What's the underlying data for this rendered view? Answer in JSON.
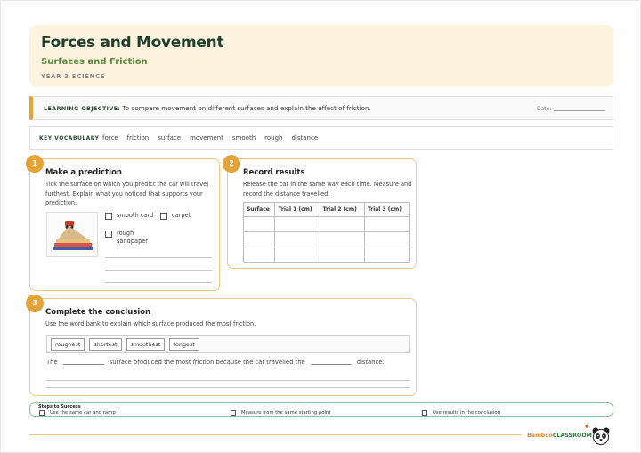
{
  "header": {
    "title": "Forces and Movement",
    "subtitle": "Surfaces and Friction",
    "year": "YEAR 3 SCIENCE"
  },
  "objective": {
    "label": "LEARNING OBJECTIVE:",
    "text": "To compare movement on different surfaces and explain the effect of friction.",
    "date_label": "Date:"
  },
  "vocabulary": {
    "label": "KEY VOCABULARY",
    "words": [
      "force",
      "friction",
      "surface",
      "movement",
      "smooth",
      "rough",
      "distance"
    ]
  },
  "prediction": {
    "number": "1",
    "title": "Make a prediction",
    "instructions": "Tick the surface on which you predict the car will travel furthest. Explain what you noticed that supports your prediction.",
    "image_icon": "car-on-ramp-picture",
    "options": [
      "smooth card",
      "carpet",
      "rough sandpaper"
    ]
  },
  "results": {
    "number": "2",
    "title": "Record results",
    "instructions": "Release the car in the same way each time. Measure and record the distance travelled.",
    "columns": [
      "Surface",
      "Trial 1 (cm)",
      "Trial 2 (cm)",
      "Trial 3 (cm)"
    ],
    "rows": [
      [
        "",
        "",
        "",
        ""
      ],
      [
        "",
        "",
        "",
        ""
      ],
      [
        "",
        "",
        "",
        ""
      ]
    ]
  },
  "conclusion": {
    "number": "3",
    "title": "Complete the conclusion",
    "instructions": "Use the word bank to explain which surface produced the most friction.",
    "word_bank": [
      "roughest",
      "shortest",
      "smoothest",
      "longest"
    ],
    "sentence": {
      "part1": "The",
      "part2": "surface produced the most friction because the car travelled the",
      "part3": "distance."
    }
  },
  "steps": {
    "title": "Steps to Success",
    "items": [
      "Use the same car and ramp",
      "Measure from the same starting point",
      "Use results in the conclusion"
    ]
  },
  "footer": {
    "brand_part1": "Bamboo",
    "brand_part2": "CLASSROOM",
    "logo_icon": "panda-logo-icon"
  },
  "colors": {
    "accent": "#e3a33b",
    "header_bg": "#fdf3de",
    "title": "#1f3d2a",
    "subtitle": "#5c8a3c",
    "steps_border": "#8fbf9a"
  }
}
